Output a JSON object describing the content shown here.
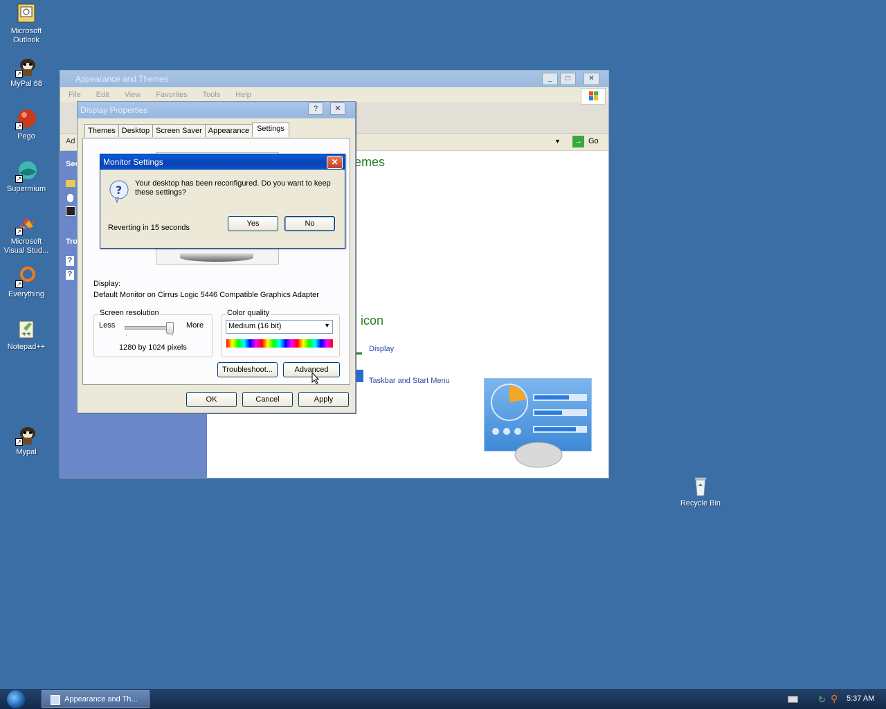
{
  "desktop": {
    "icons": [
      {
        "label": "Microsoft Outlook",
        "icon": "outlook-icon"
      },
      {
        "label": "MyPal 68",
        "icon": "mypal-icon"
      },
      {
        "label": "Pego",
        "icon": "pego-icon"
      },
      {
        "label": "Supermium",
        "icon": "supermium-icon"
      },
      {
        "label": "Microsoft Visual Stud...",
        "icon": "visual-studio-icon"
      },
      {
        "label": "Everything",
        "icon": "everything-icon"
      },
      {
        "label": "Notepad++",
        "icon": "notepadpp-icon"
      },
      {
        "label": "Mypal",
        "icon": "mypal-icon"
      },
      {
        "label": "Recycle Bin",
        "icon": "recycle-bin-icon"
      }
    ]
  },
  "explorer": {
    "title": "Appearance and Themes",
    "menu": [
      "File",
      "Edit",
      "View",
      "Favorites",
      "Tools",
      "Help"
    ],
    "address_prefix": "Ad",
    "go_label": "Go",
    "sidebar": {
      "see": "See",
      "tro": "Tro"
    },
    "headings": {
      "themes_fragment": "emes",
      "icon_fragment": "icon"
    },
    "links": {
      "display": "Display",
      "taskbar": "Taskbar and Start Menu"
    }
  },
  "display_properties": {
    "title": "Display Properties",
    "help_btn": "?",
    "close_btn": "✕",
    "tabs": [
      "Themes",
      "Desktop",
      "Screen Saver",
      "Appearance",
      "Settings"
    ],
    "display_label": "Display:",
    "display_value": "Default Monitor on Cirrus Logic 5446 Compatible Graphics Adapter",
    "resolution": {
      "label": "Screen resolution",
      "less": "Less",
      "more": "More",
      "value": "1280 by 1024 pixels",
      "slider_level": 1.0
    },
    "color": {
      "label": "Color quality",
      "value": "Medium (16 bit)"
    },
    "buttons": {
      "troubleshoot": "Troubleshoot...",
      "advanced": "Advanced",
      "ok": "OK",
      "cancel": "Cancel",
      "apply": "Apply"
    }
  },
  "monitor_settings": {
    "title": "Monitor Settings",
    "close": "✕",
    "message": "Your desktop has been reconfigured.  Do you want to keep these settings?",
    "countdown": "Reverting in 15 seconds",
    "yes": "Yes",
    "no": "No"
  },
  "taskbar": {
    "task": "Appearance and Th...",
    "clock": "5:37 AM"
  }
}
